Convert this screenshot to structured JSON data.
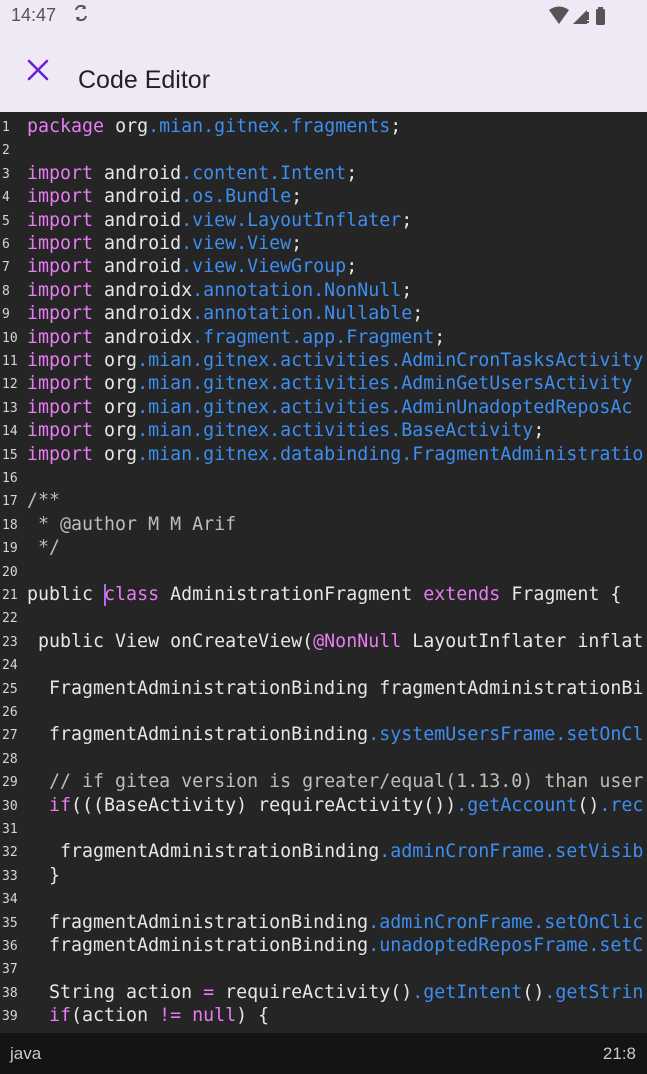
{
  "status_bar": {
    "time": "14:47",
    "sync_icon": "sync-icon",
    "wifi_icon": "wifi-icon",
    "signal_icon": "signal-icon",
    "battery_icon": "battery-icon"
  },
  "app_bar": {
    "title": "Code Editor",
    "close_icon": "close-icon",
    "accent_color": "#6b21d8"
  },
  "editor": {
    "cursor": {
      "line": 21,
      "column": 8
    },
    "lines": [
      {
        "n": "1",
        "tokens": [
          {
            "t": "package ",
            "c": "kw"
          },
          {
            "t": "org",
            "c": "plain"
          },
          {
            "t": ".mian.gitnex.fragments",
            "c": "blue"
          },
          {
            "t": ";",
            "c": "plain"
          }
        ]
      },
      {
        "n": "2",
        "tokens": []
      },
      {
        "n": "3",
        "tokens": [
          {
            "t": "import ",
            "c": "kw"
          },
          {
            "t": "android",
            "c": "plain"
          },
          {
            "t": ".content.Intent",
            "c": "blue"
          },
          {
            "t": ";",
            "c": "plain"
          }
        ]
      },
      {
        "n": "4",
        "tokens": [
          {
            "t": "import ",
            "c": "kw"
          },
          {
            "t": "android",
            "c": "plain"
          },
          {
            "t": ".os.Bundle",
            "c": "blue"
          },
          {
            "t": ";",
            "c": "plain"
          }
        ]
      },
      {
        "n": "5",
        "tokens": [
          {
            "t": "import ",
            "c": "kw"
          },
          {
            "t": "android",
            "c": "plain"
          },
          {
            "t": ".view.LayoutInflater",
            "c": "blue"
          },
          {
            "t": ";",
            "c": "plain"
          }
        ]
      },
      {
        "n": "6",
        "tokens": [
          {
            "t": "import ",
            "c": "kw"
          },
          {
            "t": "android",
            "c": "plain"
          },
          {
            "t": ".view.View",
            "c": "blue"
          },
          {
            "t": ";",
            "c": "plain"
          }
        ]
      },
      {
        "n": "7",
        "tokens": [
          {
            "t": "import ",
            "c": "kw"
          },
          {
            "t": "android",
            "c": "plain"
          },
          {
            "t": ".view.ViewGroup",
            "c": "blue"
          },
          {
            "t": ";",
            "c": "plain"
          }
        ]
      },
      {
        "n": "8",
        "tokens": [
          {
            "t": "import ",
            "c": "kw"
          },
          {
            "t": "androidx",
            "c": "plain"
          },
          {
            "t": ".annotation.NonNull",
            "c": "blue"
          },
          {
            "t": ";",
            "c": "plain"
          }
        ]
      },
      {
        "n": "9",
        "tokens": [
          {
            "t": "import ",
            "c": "kw"
          },
          {
            "t": "androidx",
            "c": "plain"
          },
          {
            "t": ".annotation.Nullable",
            "c": "blue"
          },
          {
            "t": ";",
            "c": "plain"
          }
        ]
      },
      {
        "n": "10",
        "tokens": [
          {
            "t": "import ",
            "c": "kw"
          },
          {
            "t": "androidx",
            "c": "plain"
          },
          {
            "t": ".fragment.app.Fragment",
            "c": "blue"
          },
          {
            "t": ";",
            "c": "plain"
          }
        ]
      },
      {
        "n": "11",
        "tokens": [
          {
            "t": "import ",
            "c": "kw"
          },
          {
            "t": "org",
            "c": "plain"
          },
          {
            "t": ".mian.gitnex.activities.AdminCronTasksActivity",
            "c": "blue"
          }
        ]
      },
      {
        "n": "12",
        "tokens": [
          {
            "t": "import ",
            "c": "kw"
          },
          {
            "t": "org",
            "c": "plain"
          },
          {
            "t": ".mian.gitnex.activities.AdminGetUsersActivity",
            "c": "blue"
          }
        ]
      },
      {
        "n": "13",
        "tokens": [
          {
            "t": "import ",
            "c": "kw"
          },
          {
            "t": "org",
            "c": "plain"
          },
          {
            "t": ".mian.gitnex.activities.AdminUnadoptedReposAc",
            "c": "blue"
          }
        ]
      },
      {
        "n": "14",
        "tokens": [
          {
            "t": "import ",
            "c": "kw"
          },
          {
            "t": "org",
            "c": "plain"
          },
          {
            "t": ".mian.gitnex.activities.BaseActivity",
            "c": "blue"
          },
          {
            "t": ";",
            "c": "plain"
          }
        ]
      },
      {
        "n": "15",
        "tokens": [
          {
            "t": "import ",
            "c": "kw"
          },
          {
            "t": "org",
            "c": "plain"
          },
          {
            "t": ".mian.gitnex.databinding.FragmentAdministratio",
            "c": "blue"
          }
        ]
      },
      {
        "n": "16",
        "tokens": []
      },
      {
        "n": "17",
        "tokens": [
          {
            "t": "/**",
            "c": "comment"
          }
        ]
      },
      {
        "n": "18",
        "tokens": [
          {
            "t": " * @author M M Arif",
            "c": "comment"
          }
        ]
      },
      {
        "n": "19",
        "tokens": [
          {
            "t": " */",
            "c": "comment"
          }
        ]
      },
      {
        "n": "20",
        "tokens": []
      },
      {
        "n": "21",
        "tokens": [
          {
            "t": "public ",
            "c": "plain"
          },
          {
            "t": "class ",
            "c": "kw"
          },
          {
            "t": "AdministrationFragment ",
            "c": "plain"
          },
          {
            "t": "extends ",
            "c": "kw"
          },
          {
            "t": "Fragment {",
            "c": "plain"
          }
        ]
      },
      {
        "n": "22",
        "tokens": []
      },
      {
        "n": "23",
        "tokens": [
          {
            "t": " public View onCreateView(",
            "c": "plain"
          },
          {
            "t": "@NonNull",
            "c": "ann"
          },
          {
            "t": " LayoutInflater inflat",
            "c": "plain"
          }
        ]
      },
      {
        "n": "24",
        "tokens": []
      },
      {
        "n": "25",
        "tokens": [
          {
            "t": "  FragmentAdministrationBinding fragmentAdministrationBi",
            "c": "plain"
          }
        ]
      },
      {
        "n": "26",
        "tokens": []
      },
      {
        "n": "27",
        "tokens": [
          {
            "t": "  fragmentAdministrationBinding",
            "c": "plain"
          },
          {
            "t": ".systemUsersFrame.setOnCl",
            "c": "blue"
          }
        ]
      },
      {
        "n": "28",
        "tokens": []
      },
      {
        "n": "29",
        "tokens": [
          {
            "t": "  // if gitea version is greater/equal(1.13.0) than user",
            "c": "comment"
          }
        ]
      },
      {
        "n": "30",
        "tokens": [
          {
            "t": "  ",
            "c": "plain"
          },
          {
            "t": "if",
            "c": "kw"
          },
          {
            "t": "(((BaseActivity) requireActivity())",
            "c": "plain"
          },
          {
            "t": ".getAccount",
            "c": "blue"
          },
          {
            "t": "()",
            "c": "plain"
          },
          {
            "t": ".rec",
            "c": "blue"
          }
        ]
      },
      {
        "n": "31",
        "tokens": []
      },
      {
        "n": "32",
        "tokens": [
          {
            "t": "   fragmentAdministrationBinding",
            "c": "plain"
          },
          {
            "t": ".adminCronFrame.setVisib",
            "c": "blue"
          }
        ]
      },
      {
        "n": "33",
        "tokens": [
          {
            "t": "  }",
            "c": "plain"
          }
        ]
      },
      {
        "n": "34",
        "tokens": []
      },
      {
        "n": "35",
        "tokens": [
          {
            "t": "  fragmentAdministrationBinding",
            "c": "plain"
          },
          {
            "t": ".adminCronFrame.setOnClic",
            "c": "blue"
          }
        ]
      },
      {
        "n": "36",
        "tokens": [
          {
            "t": "  fragmentAdministrationBinding",
            "c": "plain"
          },
          {
            "t": ".unadoptedReposFrame.setC",
            "c": "blue"
          }
        ]
      },
      {
        "n": "37",
        "tokens": []
      },
      {
        "n": "38",
        "tokens": [
          {
            "t": "  String action ",
            "c": "plain"
          },
          {
            "t": "=",
            "c": "kw"
          },
          {
            "t": " requireActivity()",
            "c": "plain"
          },
          {
            "t": ".getIntent",
            "c": "blue"
          },
          {
            "t": "()",
            "c": "plain"
          },
          {
            "t": ".getStrin",
            "c": "blue"
          }
        ]
      },
      {
        "n": "39",
        "tokens": [
          {
            "t": "  ",
            "c": "plain"
          },
          {
            "t": "if",
            "c": "kw"
          },
          {
            "t": "(action ",
            "c": "plain"
          },
          {
            "t": "!=",
            "c": "kw"
          },
          {
            "t": " ",
            "c": "plain"
          },
          {
            "t": "null",
            "c": "kw"
          },
          {
            "t": ") {",
            "c": "plain"
          }
        ]
      }
    ]
  },
  "bottom_bar": {
    "language": "java",
    "position": "21:8"
  }
}
